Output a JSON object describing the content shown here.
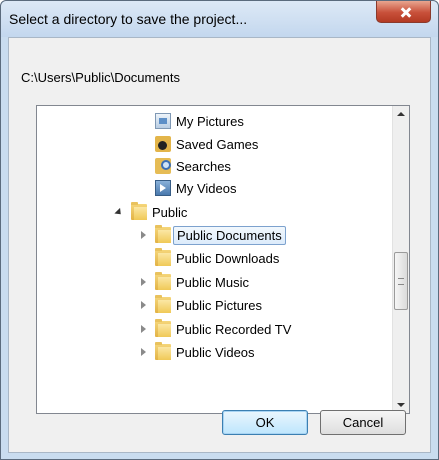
{
  "window": {
    "title": "Select a directory to save the project..."
  },
  "path_label": "C:\\Users\\Public\\Documents",
  "tree": {
    "items": [
      {
        "label": "My Pictures",
        "icon": "pictures-icon",
        "expander": "none",
        "indent": 2
      },
      {
        "label": "Saved Games",
        "icon": "saved-games-icon",
        "expander": "none",
        "indent": 2
      },
      {
        "label": "Searches",
        "icon": "searches-icon",
        "expander": "none",
        "indent": 2
      },
      {
        "label": "My Videos",
        "icon": "videos-icon",
        "expander": "none",
        "indent": 2
      },
      {
        "label": "Public",
        "icon": "folder-icon",
        "expander": "expanded",
        "indent": 1
      },
      {
        "label": "Public Documents",
        "icon": "folder-icon",
        "expander": "collapsed",
        "indent": 2,
        "selected": true
      },
      {
        "label": "Public Downloads",
        "icon": "folder-icon",
        "expander": "none",
        "indent": 2
      },
      {
        "label": "Public Music",
        "icon": "folder-icon",
        "expander": "collapsed",
        "indent": 2
      },
      {
        "label": "Public Pictures",
        "icon": "folder-icon",
        "expander": "collapsed",
        "indent": 2
      },
      {
        "label": "Public Recorded TV",
        "icon": "folder-icon",
        "expander": "collapsed",
        "indent": 2
      },
      {
        "label": "Public Videos",
        "icon": "folder-icon",
        "expander": "collapsed",
        "indent": 2
      }
    ]
  },
  "buttons": {
    "ok": "OK",
    "cancel": "Cancel"
  },
  "colors": {
    "titlebar": "#c3d7ee",
    "close_button": "#c8503a",
    "selection_border": "#7da2ce",
    "ok_accent": "#3c7fb1"
  }
}
